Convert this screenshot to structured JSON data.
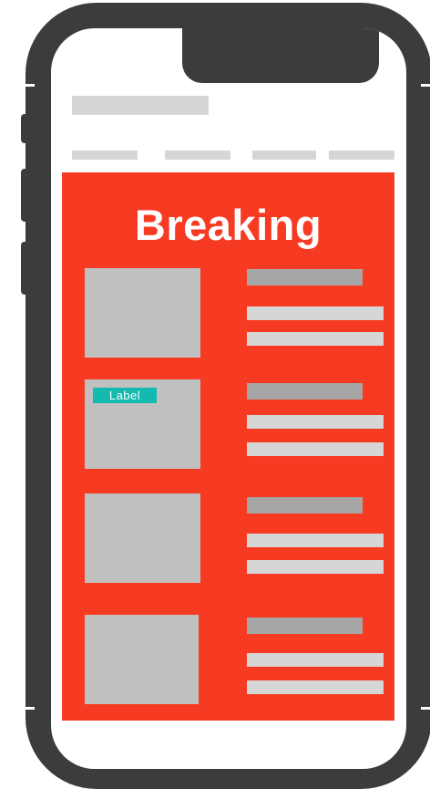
{
  "panel": {
    "title": "Breaking"
  },
  "articles": [
    {
      "badge": ""
    },
    {
      "badge": "Label"
    },
    {
      "badge": ""
    },
    {
      "badge": ""
    }
  ],
  "colors": {
    "frame": "#3c3c3c",
    "panel": "#f73b23",
    "badge": "#14b9b0",
    "placeholder_light": "#d6d6d6",
    "placeholder_mid": "#a6a6a6",
    "thumbnail": "#c0c0c0"
  }
}
